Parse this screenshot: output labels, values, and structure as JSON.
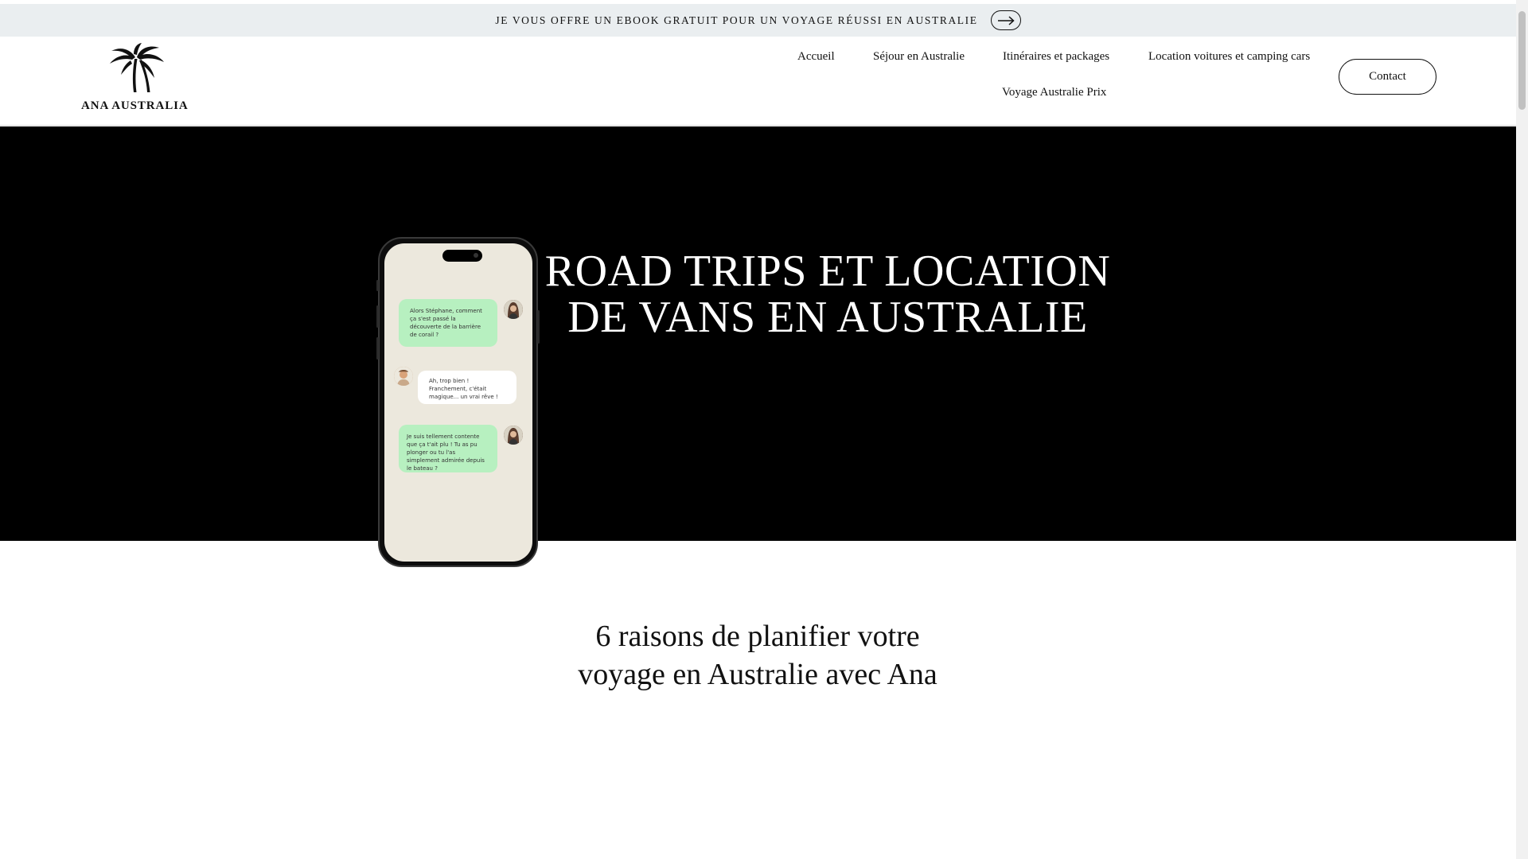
{
  "banner": {
    "text": "JE VOUS OFFRE UN EBOOK GRATUIT POUR UN VOYAGE RÉUSSI EN AUSTRALIE",
    "arrow_icon": "arrow-right-icon"
  },
  "logo": {
    "text": "ANA  AUSTRALIA",
    "icon": "palm-tree-icon"
  },
  "nav": {
    "items": [
      {
        "label": "Accueil"
      },
      {
        "label": "Séjour en Australie"
      },
      {
        "label": "Itinéraires et packages"
      },
      {
        "label": "Location voitures et camping cars"
      },
      {
        "label": "Voyage Australie Prix"
      }
    ],
    "contact": "Contact"
  },
  "hero": {
    "title_line1": "ROAD TRIPS ET LOCATION",
    "title_line2": "DE VANS EN AUSTRALIE",
    "chat": [
      {
        "side": "right",
        "text": "Alors Stéphane, comment ça s'est passé la découverte de la barrière de corail ?"
      },
      {
        "side": "left",
        "text": "Ah, trop bien ! Franchement, c'était magique... un vrai rêve !"
      },
      {
        "side": "right",
        "text": "Je suis tellement contente que ça t'ait plu ! Tu as pu plonger ou tu l'as simplement admirée depuis le bateau ?"
      }
    ]
  },
  "section": {
    "title_line1": "6 raisons de planifier votre",
    "title_line2": "voyage en Australie avec Ana"
  },
  "colors": {
    "banner_bg": "#eaeef0",
    "hero_bg": "#000000",
    "chat_green": "#b7f0c0",
    "phone_screen": "#ece8dd"
  }
}
